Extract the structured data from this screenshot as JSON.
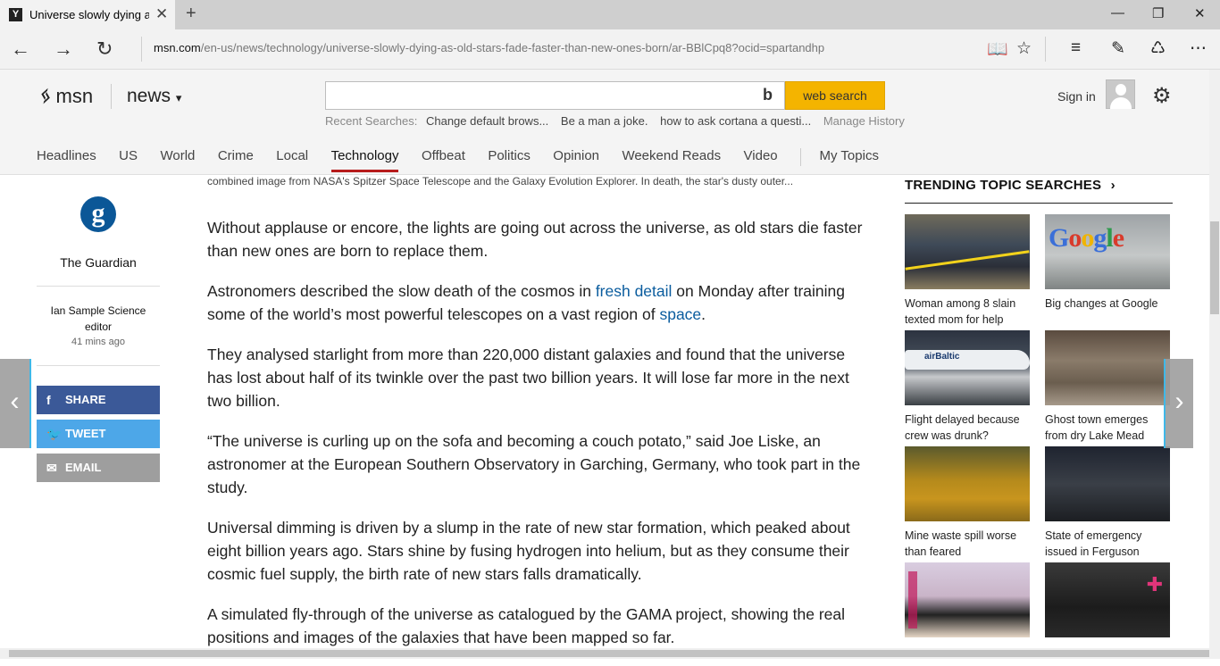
{
  "browser": {
    "tab_title": "Universe slowly dying as",
    "favicon": "Y",
    "url_host": "msn.com",
    "url_path": "/en-us/news/technology/universe-slowly-dying-as-old-stars-fade-faster-than-new-ones-born/ar-BBlCpq8?ocid=spartandhp",
    "icons": [
      "back-icon",
      "forward-icon",
      "refresh-icon",
      "reading-view-icon",
      "favorite-star-icon",
      "hub-icon",
      "web-note-icon",
      "share-icon",
      "more-icon"
    ]
  },
  "header": {
    "logo": "msn",
    "section": "news",
    "search_button": "web search",
    "recent_label": "Recent Searches:",
    "recent_items": [
      "Change default brows...",
      "Be a man a joke.",
      "how to ask cortana a questi..."
    ],
    "manage_history": "Manage History",
    "signin": "Sign in"
  },
  "nav": {
    "items": [
      "Headlines",
      "US",
      "World",
      "Crime",
      "Local",
      "Technology",
      "Offbeat",
      "Politics",
      "Opinion",
      "Weekend Reads",
      "Video"
    ],
    "active": "Technology",
    "my_topics": "My Topics"
  },
  "source": {
    "logo_letter": "g",
    "name": "The Guardian",
    "author": "Ian Sample Science editor",
    "age": "41 mins ago"
  },
  "share": {
    "facebook": "SHARE",
    "twitter": "TWEET",
    "email": "EMAIL"
  },
  "article": {
    "caption": "combined image from NASA's Spitzer Space Telescope and the Galaxy Evolution Explorer. In death, the star's dusty outer...",
    "p1": "Without applause or encore, the lights are going out across the universe, as old stars die faster than new ones are born to replace them.",
    "p2_a": "Astronomers described the slow death of the cosmos in ",
    "p2_link1": "fresh detail",
    "p2_b": " on Monday after training some of the world’s most powerful telescopes on a vast region of ",
    "p2_link2": "space",
    "p2_c": ".",
    "p3": "They analysed starlight from more than 220,000 distant galaxies and found that the universe has lost about half of its twinkle over the past two billion years. It will lose far more in the next two billion.",
    "p4": "“The universe is curling up on the sofa and becoming a couch potato,” said Joe Liske, an astronomer at the European Southern Observatory in Garching, Germany, who took part in the study.",
    "p5": "Universal dimming is driven by a slump in the rate of new star formation, which peaked about eight billion years ago. Stars shine by fusing hydrogen into helium, but as they consume their cosmic fuel supply, the birth rate of new stars falls dramatically.",
    "p6": "A simulated fly-through of the universe as catalogued by the GAMA project, showing the real positions and images of the galaxies that have been mapped so far."
  },
  "trending": {
    "title": "TRENDING TOPIC SEARCHES",
    "items": [
      {
        "caption": "Woman among 8 slain texted mom for help"
      },
      {
        "caption": "Big changes at Google",
        "thumb_text": "Google"
      },
      {
        "caption": "Flight delayed because crew was drunk?",
        "thumb_text": "airBaltic"
      },
      {
        "caption": "Ghost town emerges from dry Lake Mead"
      },
      {
        "caption": "Mine waste spill worse than feared"
      },
      {
        "caption": "State of emergency issued in Ferguson"
      },
      {
        "caption": ""
      },
      {
        "caption": ""
      }
    ]
  }
}
